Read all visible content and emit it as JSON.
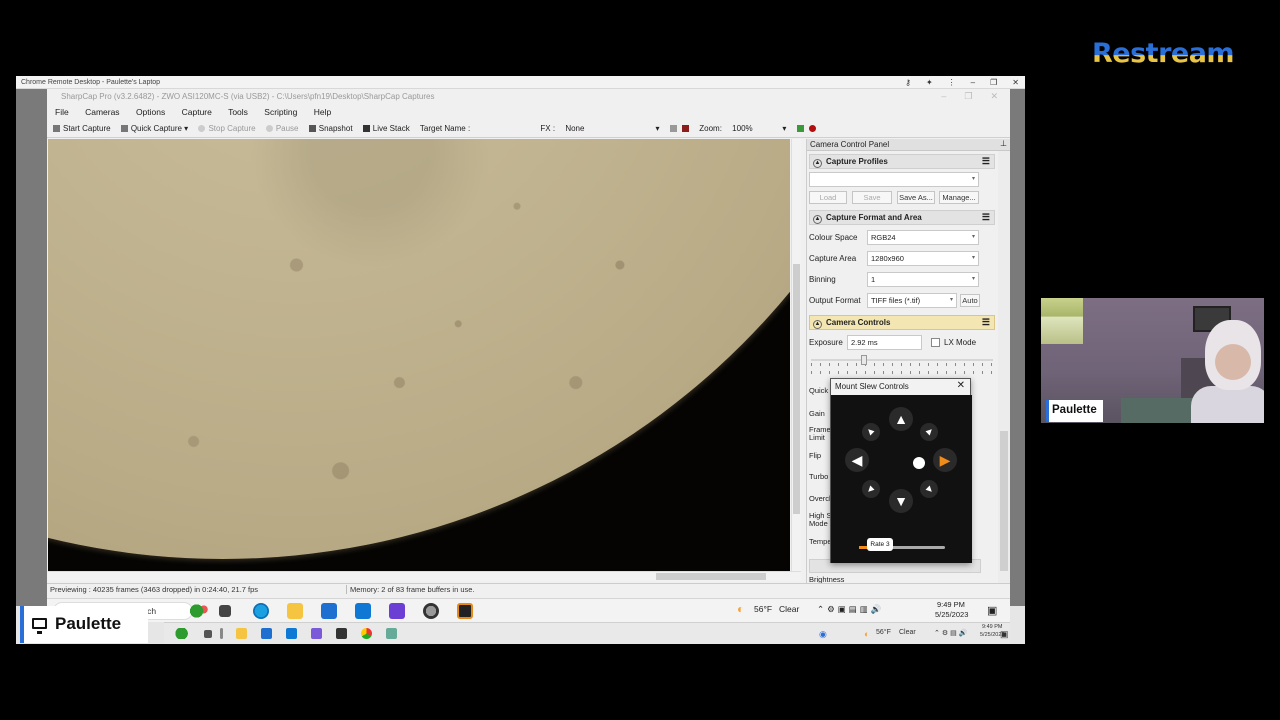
{
  "brand": {
    "logo": "Restream"
  },
  "remote_desktop": {
    "title": "Chrome Remote Desktop - Paulette's Laptop"
  },
  "app": {
    "title": "SharpCap Pro (v3.2.6482) - ZWO ASI120MC-S (via USB2) - C:\\Users\\pfn19\\Desktop\\SharpCap Captures",
    "menu": [
      "File",
      "Cameras",
      "Options",
      "Capture",
      "Tools",
      "Scripting",
      "Help"
    ],
    "toolbar": {
      "start_capture": "Start Capture",
      "quick_capture": "Quick Capture",
      "stop_capture": "Stop Capture",
      "pause": "Pause",
      "snapshot": "Snapshot",
      "live_stack": "Live Stack",
      "target_name": "Target Name :",
      "fx_label": "FX :",
      "fx_value": "None",
      "zoom_label": "Zoom:",
      "zoom_value": "100%"
    },
    "status": {
      "preview": "Previewing : 40235 frames (3463 dropped) in 0:24:40, 21.7 fps",
      "memory": "Memory: 2 of 83 frame buffers in use."
    }
  },
  "panel": {
    "title": "Camera Control Panel",
    "capture_profiles": {
      "header": "Capture Profiles",
      "buttons": {
        "load": "Load",
        "save": "Save",
        "save_as": "Save As...",
        "manage": "Manage..."
      }
    },
    "capture_format": {
      "header": "Capture Format and Area",
      "colour_space_label": "Colour Space",
      "colour_space": "RGB24",
      "capture_area_label": "Capture Area",
      "capture_area": "1280x960",
      "binning_label": "Binning",
      "binning": "1",
      "output_format_label": "Output Format",
      "output_format": "TIFF files (*.tif)",
      "auto": "Auto"
    },
    "camera_controls": {
      "header": "Camera Controls",
      "exposure_label": "Exposure",
      "exposure": "2.92 ms",
      "lx_mode": "LX Mode",
      "partial_labels": [
        "Quick",
        "Gain",
        "Frame\nLimit",
        "Flip",
        "Turbo",
        "Overcl",
        "High S\nMode",
        "Tempe",
        "Brightness"
      ]
    }
  },
  "slew": {
    "title": "Mount Slew Controls",
    "rate": "Rate 3",
    "rate_level": 0.17
  },
  "taskbar": {
    "search": "e to search",
    "weather": "56°F",
    "condition": "Clear",
    "time": "9:49 PM",
    "date": "5/25/2023"
  },
  "taskbar2": {
    "weather": "56°F",
    "condition": "Clear",
    "time": "9:49 PM",
    "date": "5/25/2023"
  },
  "participants": {
    "presenter": "Paulette",
    "webcam": "Paulette"
  }
}
